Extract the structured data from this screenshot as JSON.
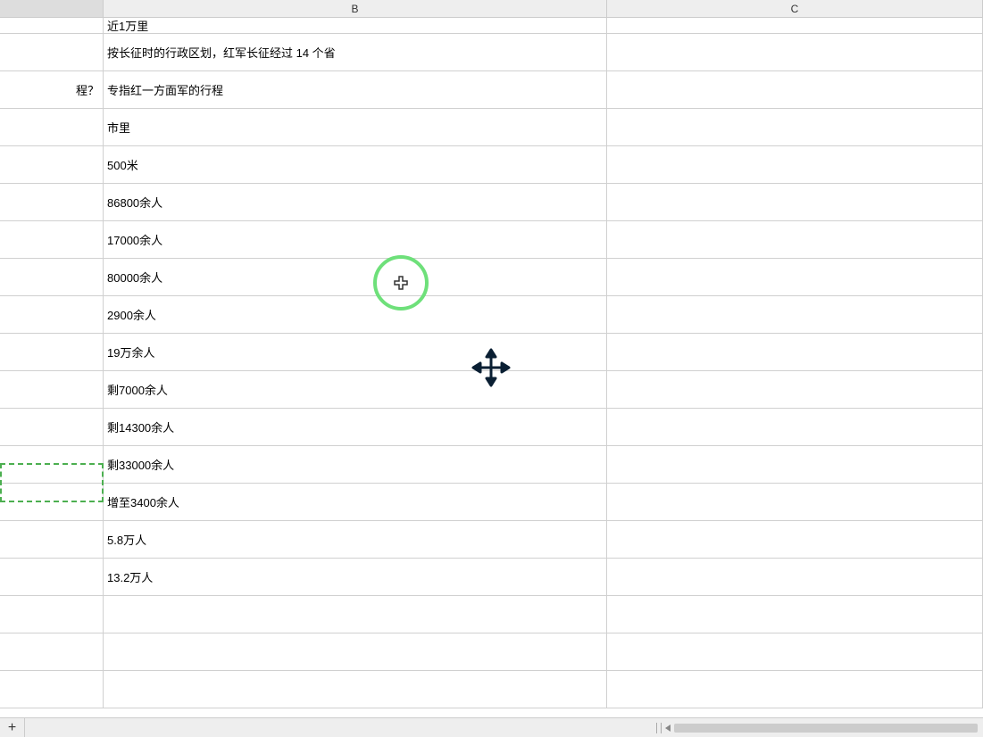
{
  "columns": {
    "a": "",
    "b": "B",
    "c": "C"
  },
  "rows": [
    {
      "a": "",
      "b": "近1万里",
      "c": ""
    },
    {
      "a": "",
      "b": "按长征时的行政区划，红军长征经过 14 个省",
      "c": ""
    },
    {
      "a": "程？",
      "b": "专指红一方面军的行程",
      "c": ""
    },
    {
      "a": "",
      "b": "市里",
      "c": ""
    },
    {
      "a": "",
      "b": "500米",
      "c": ""
    },
    {
      "a": "",
      "b": "86800余人",
      "c": ""
    },
    {
      "a": "",
      "b": "17000余人",
      "c": ""
    },
    {
      "a": "",
      "b": "80000余人",
      "c": ""
    },
    {
      "a": "",
      "b": "2900余人",
      "c": ""
    },
    {
      "a": "",
      "b": "19万余人",
      "c": ""
    },
    {
      "a": "",
      "b": "剩7000余人",
      "c": ""
    },
    {
      "a": "",
      "b": "剩14300余人",
      "c": ""
    },
    {
      "a": "",
      "b": "剩33000余人",
      "c": ""
    },
    {
      "a": "",
      "b": "增至3400余人",
      "c": ""
    },
    {
      "a": "",
      "b": "5.8万人",
      "c": ""
    },
    {
      "a": "",
      "b": "13.2万人",
      "c": ""
    },
    {
      "a": "",
      "b": "",
      "c": ""
    },
    {
      "a": "",
      "b": "",
      "c": ""
    },
    {
      "a": "",
      "b": "",
      "c": ""
    }
  ],
  "addSheet": "+"
}
